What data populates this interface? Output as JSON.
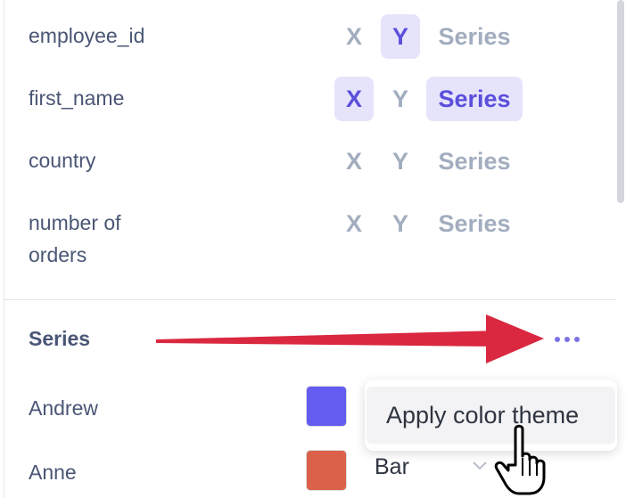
{
  "fields": [
    {
      "name": "employee_id",
      "x": "X",
      "y": "Y",
      "series": "Series",
      "active": [
        "y"
      ]
    },
    {
      "name": "first_name",
      "x": "X",
      "y": "Y",
      "series": "Series",
      "active": [
        "x",
        "series"
      ]
    },
    {
      "name": "country",
      "x": "X",
      "y": "Y",
      "series": "Series",
      "active": []
    },
    {
      "name_line1": "number of",
      "name_line2": "orders",
      "x": "X",
      "y": "Y",
      "series": "Series",
      "active": []
    }
  ],
  "series_section": {
    "heading": "Series",
    "items": [
      {
        "name": "Andrew",
        "color": "#645bf0"
      },
      {
        "name": "Anne",
        "color": "#dc614a",
        "type": "Bar"
      }
    ]
  },
  "menu": {
    "apply_color_theme": "Apply color theme"
  },
  "colors": {
    "accent": "#5b4fdc",
    "accent_bg": "#e6e4fb",
    "arrow": "#d9283f"
  },
  "icons": {
    "more": "more-dots-icon",
    "chevron": "chevron-down-icon",
    "cursor": "hand-pointer-icon",
    "arrow": "red-arrow-annotation"
  }
}
